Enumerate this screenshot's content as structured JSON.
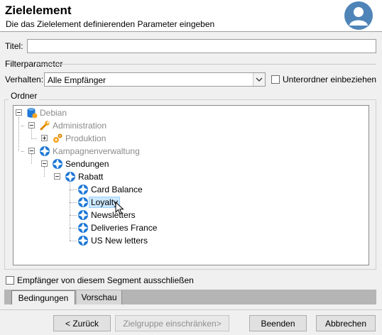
{
  "header": {
    "title": "Zielelement",
    "subtitle": "Die das Zielelement definierenden Parameter eingeben"
  },
  "form": {
    "title_label": "Titel:",
    "title_value": "",
    "filter_section": "Filterparameter",
    "behavior_label": "Verhalten:",
    "behavior_value": "Alle Empfänger",
    "subfolders_label": "Unterordner einbeziehen",
    "subfolders_checked": false,
    "folder_section": "Ordner"
  },
  "tree": {
    "nodes": [
      {
        "label": "Debian",
        "icon": "database-icon",
        "muted": true
      },
      {
        "label": "Administration",
        "icon": "wrench-icon",
        "muted": true
      },
      {
        "label": "Produktion",
        "icon": "gears-icon",
        "muted": true
      },
      {
        "label": "Kampagnenverwaltung",
        "icon": "campaign-folder-icon",
        "muted": true
      },
      {
        "label": "Sendungen",
        "icon": "campaign-folder-icon",
        "muted": false
      },
      {
        "label": "Rabatt",
        "icon": "campaign-folder-icon",
        "muted": false
      },
      {
        "label": "Card Balance",
        "icon": "campaign-folder-icon",
        "muted": false
      },
      {
        "label": "Loyalty",
        "icon": "campaign-folder-icon",
        "muted": false,
        "selected": true
      },
      {
        "label": "Newsletters",
        "icon": "campaign-folder-icon",
        "muted": false
      },
      {
        "label": "Deliveries France",
        "icon": "campaign-folder-icon",
        "muted": false
      },
      {
        "label": "US New letters",
        "icon": "campaign-folder-icon",
        "muted": false
      }
    ]
  },
  "exclude_label": "Empfänger von diesem Segment ausschließen",
  "exclude_checked": false,
  "tabs": [
    "Bedingungen",
    "Vorschau"
  ],
  "buttons": {
    "back": "< Zurück",
    "restrict": "Zielgruppe einschränken>",
    "finish": "Beenden",
    "cancel": "Abbrechen"
  },
  "colors": {
    "accent_blue": "#1e78d6",
    "selection": "#cce8ff",
    "avatar": "#4f84b8"
  }
}
